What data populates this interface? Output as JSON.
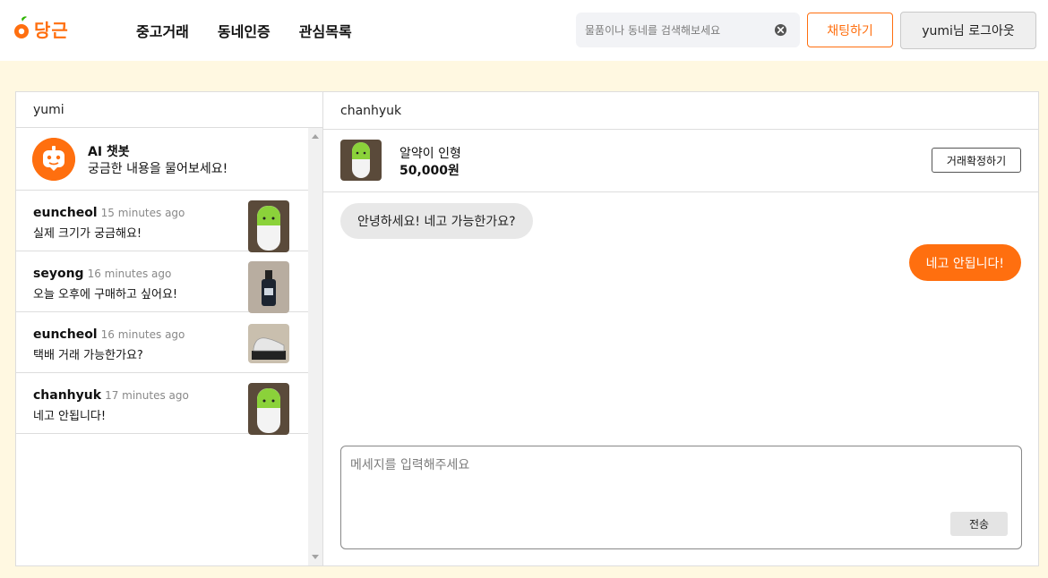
{
  "header": {
    "logo_text": "당근",
    "nav": [
      "중고거래",
      "동네인증",
      "관심목록"
    ],
    "search_placeholder": "물품이나 동네를 검색해보세요",
    "chat_button": "채팅하기",
    "logout_button": "yumi님 로그아웃"
  },
  "sidebar": {
    "username": "yumi",
    "bot": {
      "name": "AI 챗봇",
      "desc": "궁금한 내용을 물어보세요!"
    },
    "chats": [
      {
        "name": "euncheol",
        "time": "15 minutes ago",
        "message": "실제 크기가 궁금해요!",
        "thumb": "green-doll"
      },
      {
        "name": "seyong",
        "time": "16 minutes ago",
        "message": "오늘 오후에 구매하고 싶어요!",
        "thumb": "bottle"
      },
      {
        "name": "euncheol",
        "time": "16 minutes ago",
        "message": "택배 거래 가능한가요?",
        "thumb": "sneakers"
      },
      {
        "name": "chanhyuk",
        "time": "17 minutes ago",
        "message": "네고 안됩니다!",
        "thumb": "green-doll"
      }
    ]
  },
  "conversation": {
    "partner": "chanhyuk",
    "product": {
      "title": "알약이 인형",
      "price": "50,000원"
    },
    "confirm_button": "거래확정하기",
    "messages": [
      {
        "side": "received",
        "text": "안녕하세요! 네고 가능한가요?"
      },
      {
        "side": "sent",
        "text": "네고 안됩니다!"
      }
    ],
    "input_placeholder": "메세지를 입력해주세요",
    "send_button": "전송"
  },
  "colors": {
    "accent": "#ff6f0f",
    "background": "#fff8e1"
  }
}
